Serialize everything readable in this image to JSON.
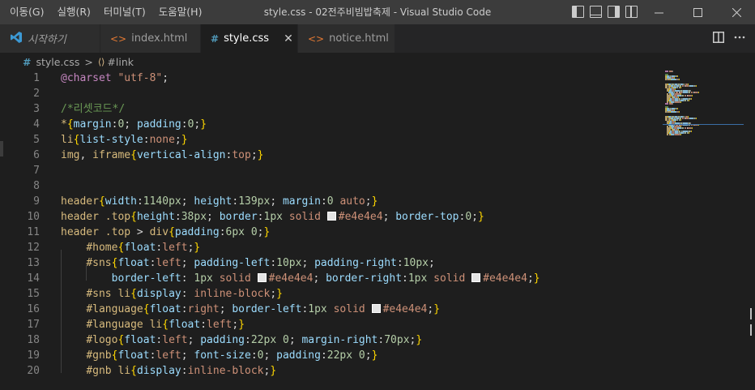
{
  "menu": [
    "이동(G)",
    "실행(R)",
    "터미널(T)",
    "도움말(H)"
  ],
  "window_title": "style.css - 02전주비빔밥축제 - Visual Studio Code",
  "window_controls": {
    "minimize": "—",
    "maximize": "☐",
    "close": "✕"
  },
  "tabs": [
    {
      "label": "시작하기",
      "icon": "vscode-logo-icon",
      "glyph": "◆",
      "color": "#3c99d4",
      "active": false
    },
    {
      "label": "index.html",
      "icon": "html-file-icon",
      "glyph": "<>",
      "color": "#e37933",
      "active": false
    },
    {
      "label": "style.css",
      "icon": "css-file-icon",
      "glyph": "#",
      "color": "#519aba",
      "active": true,
      "close": "✕"
    },
    {
      "label": "notice.html",
      "icon": "html-file-icon",
      "glyph": "<>",
      "color": "#e37933",
      "active": false
    }
  ],
  "breadcrumb": {
    "file": "style.css",
    "separator": ">",
    "symbol_icon": "⟨⟩",
    "symbol": "#link"
  },
  "line_numbers": [
    "1",
    "2",
    "3",
    "4",
    "5",
    "6",
    "7",
    "8",
    "9",
    "10",
    "11",
    "12",
    "13",
    "14",
    "15",
    "16",
    "17",
    "18",
    "19",
    "20"
  ],
  "code_lines": [
    [
      [
        "t-at",
        "@charset"
      ],
      [
        "t-punc",
        " "
      ],
      [
        "t-str",
        "\"utf-8\""
      ],
      [
        "t-punc",
        ";"
      ]
    ],
    [],
    [
      [
        "t-cm",
        "/*리셋코드*/"
      ]
    ],
    [
      [
        "t-sel",
        "*"
      ],
      [
        "t-br",
        "{"
      ],
      [
        "t-prop",
        "margin"
      ],
      [
        "t-punc",
        ":"
      ],
      [
        "t-num",
        "0"
      ],
      [
        "t-punc",
        "; "
      ],
      [
        "t-prop",
        "padding"
      ],
      [
        "t-punc",
        ":"
      ],
      [
        "t-num",
        "0"
      ],
      [
        "t-punc",
        ";"
      ],
      [
        "t-br",
        "}"
      ]
    ],
    [
      [
        "t-tag",
        "li"
      ],
      [
        "t-br",
        "{"
      ],
      [
        "t-prop",
        "list-style"
      ],
      [
        "t-punc",
        ":"
      ],
      [
        "t-val",
        "none"
      ],
      [
        "t-punc",
        ";"
      ],
      [
        "t-br",
        "}"
      ]
    ],
    [
      [
        "t-tag",
        "img"
      ],
      [
        "t-punc",
        ", "
      ],
      [
        "t-tag",
        "iframe"
      ],
      [
        "t-br",
        "{"
      ],
      [
        "t-prop",
        "vertical-align"
      ],
      [
        "t-punc",
        ":"
      ],
      [
        "t-val",
        "top"
      ],
      [
        "t-punc",
        ";"
      ],
      [
        "t-br",
        "}"
      ]
    ],
    [],
    [],
    [
      [
        "t-tag",
        "header"
      ],
      [
        "t-br",
        "{"
      ],
      [
        "t-prop",
        "width"
      ],
      [
        "t-punc",
        ":"
      ],
      [
        "t-num",
        "1140px"
      ],
      [
        "t-punc",
        "; "
      ],
      [
        "t-prop",
        "height"
      ],
      [
        "t-punc",
        ":"
      ],
      [
        "t-num",
        "139px"
      ],
      [
        "t-punc",
        "; "
      ],
      [
        "t-prop",
        "margin"
      ],
      [
        "t-punc",
        ":"
      ],
      [
        "t-num",
        "0"
      ],
      [
        "t-punc",
        " "
      ],
      [
        "t-val",
        "auto"
      ],
      [
        "t-punc",
        ";"
      ],
      [
        "t-br",
        "}"
      ]
    ],
    [
      [
        "t-tag",
        "header"
      ],
      [
        "t-punc",
        " "
      ],
      [
        "t-sel",
        ".top"
      ],
      [
        "t-br",
        "{"
      ],
      [
        "t-prop",
        "height"
      ],
      [
        "t-punc",
        ":"
      ],
      [
        "t-num",
        "38px"
      ],
      [
        "t-punc",
        "; "
      ],
      [
        "t-prop",
        "border"
      ],
      [
        "t-punc",
        ":"
      ],
      [
        "t-num",
        "1px"
      ],
      [
        "t-punc",
        " "
      ],
      [
        "t-val",
        "solid"
      ],
      [
        "t-punc",
        " "
      ],
      [
        "swatch",
        ""
      ],
      [
        "t-val",
        "#e4e4e4"
      ],
      [
        "t-punc",
        "; "
      ],
      [
        "t-prop",
        "border-top"
      ],
      [
        "t-punc",
        ":"
      ],
      [
        "t-num",
        "0"
      ],
      [
        "t-punc",
        ";"
      ],
      [
        "t-br",
        "}"
      ]
    ],
    [
      [
        "t-tag",
        "header"
      ],
      [
        "t-punc",
        " "
      ],
      [
        "t-sel",
        ".top"
      ],
      [
        "t-punc",
        " > "
      ],
      [
        "t-tag",
        "div"
      ],
      [
        "t-br",
        "{"
      ],
      [
        "t-prop",
        "padding"
      ],
      [
        "t-punc",
        ":"
      ],
      [
        "t-num",
        "6px"
      ],
      [
        "t-punc",
        " "
      ],
      [
        "t-num",
        "0"
      ],
      [
        "t-punc",
        ";"
      ],
      [
        "t-br",
        "}"
      ]
    ],
    [
      [
        "t-punc",
        "    "
      ],
      [
        "t-sel",
        "#home"
      ],
      [
        "t-br",
        "{"
      ],
      [
        "t-prop",
        "float"
      ],
      [
        "t-punc",
        ":"
      ],
      [
        "t-val",
        "left"
      ],
      [
        "t-punc",
        ";"
      ],
      [
        "t-br",
        "}"
      ]
    ],
    [
      [
        "t-punc",
        "    "
      ],
      [
        "t-sel",
        "#sns"
      ],
      [
        "t-br",
        "{"
      ],
      [
        "t-prop",
        "float"
      ],
      [
        "t-punc",
        ":"
      ],
      [
        "t-val",
        "left"
      ],
      [
        "t-punc",
        "; "
      ],
      [
        "t-prop",
        "padding-left"
      ],
      [
        "t-punc",
        ":"
      ],
      [
        "t-num",
        "10px"
      ],
      [
        "t-punc",
        "; "
      ],
      [
        "t-prop",
        "padding-right"
      ],
      [
        "t-punc",
        ":"
      ],
      [
        "t-num",
        "10px"
      ],
      [
        "t-punc",
        ";"
      ]
    ],
    [
      [
        "t-punc",
        "        "
      ],
      [
        "t-prop",
        "border-left"
      ],
      [
        "t-punc",
        ": "
      ],
      [
        "t-num",
        "1px"
      ],
      [
        "t-punc",
        " "
      ],
      [
        "t-val",
        "solid"
      ],
      [
        "t-punc",
        " "
      ],
      [
        "swatch",
        ""
      ],
      [
        "t-val",
        "#e4e4e4"
      ],
      [
        "t-punc",
        "; "
      ],
      [
        "t-prop",
        "border-right"
      ],
      [
        "t-punc",
        ":"
      ],
      [
        "t-num",
        "1px"
      ],
      [
        "t-punc",
        " "
      ],
      [
        "t-val",
        "solid"
      ],
      [
        "t-punc",
        " "
      ],
      [
        "swatch",
        ""
      ],
      [
        "t-val",
        "#e4e4e4"
      ],
      [
        "t-punc",
        ";"
      ],
      [
        "t-br",
        "}"
      ]
    ],
    [
      [
        "t-punc",
        "    "
      ],
      [
        "t-sel",
        "#sns"
      ],
      [
        "t-punc",
        " "
      ],
      [
        "t-tag",
        "li"
      ],
      [
        "t-br",
        "{"
      ],
      [
        "t-prop",
        "display"
      ],
      [
        "t-punc",
        ": "
      ],
      [
        "t-val",
        "inline-block"
      ],
      [
        "t-punc",
        ";"
      ],
      [
        "t-br",
        "}"
      ]
    ],
    [
      [
        "t-punc",
        "    "
      ],
      [
        "t-sel",
        "#language"
      ],
      [
        "t-br",
        "{"
      ],
      [
        "t-prop",
        "float"
      ],
      [
        "t-punc",
        ":"
      ],
      [
        "t-val",
        "right"
      ],
      [
        "t-punc",
        "; "
      ],
      [
        "t-prop",
        "border-left"
      ],
      [
        "t-punc",
        ":"
      ],
      [
        "t-num",
        "1px"
      ],
      [
        "t-punc",
        " "
      ],
      [
        "t-val",
        "solid"
      ],
      [
        "t-punc",
        " "
      ],
      [
        "swatch",
        ""
      ],
      [
        "t-val",
        "#e4e4e4"
      ],
      [
        "t-punc",
        ";"
      ],
      [
        "t-br",
        "}"
      ]
    ],
    [
      [
        "t-punc",
        "    "
      ],
      [
        "t-sel",
        "#language"
      ],
      [
        "t-punc",
        " "
      ],
      [
        "t-tag",
        "li"
      ],
      [
        "t-br",
        "{"
      ],
      [
        "t-prop",
        "float"
      ],
      [
        "t-punc",
        ":"
      ],
      [
        "t-val",
        "left"
      ],
      [
        "t-punc",
        ";"
      ],
      [
        "t-br",
        "}"
      ]
    ],
    [
      [
        "t-punc",
        "    "
      ],
      [
        "t-sel",
        "#logo"
      ],
      [
        "t-br",
        "{"
      ],
      [
        "t-prop",
        "float"
      ],
      [
        "t-punc",
        ":"
      ],
      [
        "t-val",
        "left"
      ],
      [
        "t-punc",
        "; "
      ],
      [
        "t-prop",
        "padding"
      ],
      [
        "t-punc",
        ":"
      ],
      [
        "t-num",
        "22px"
      ],
      [
        "t-punc",
        " "
      ],
      [
        "t-num",
        "0"
      ],
      [
        "t-punc",
        "; "
      ],
      [
        "t-prop",
        "margin-right"
      ],
      [
        "t-punc",
        ":"
      ],
      [
        "t-num",
        "70px"
      ],
      [
        "t-punc",
        ";"
      ],
      [
        "t-br",
        "}"
      ]
    ],
    [
      [
        "t-punc",
        "    "
      ],
      [
        "t-sel",
        "#gnb"
      ],
      [
        "t-br",
        "{"
      ],
      [
        "t-prop",
        "float"
      ],
      [
        "t-punc",
        ":"
      ],
      [
        "t-val",
        "left"
      ],
      [
        "t-punc",
        "; "
      ],
      [
        "t-prop",
        "font-size"
      ],
      [
        "t-punc",
        ":"
      ],
      [
        "t-num",
        "0"
      ],
      [
        "t-punc",
        "; "
      ],
      [
        "t-prop",
        "padding"
      ],
      [
        "t-punc",
        ":"
      ],
      [
        "t-num",
        "22px"
      ],
      [
        "t-punc",
        " "
      ],
      [
        "t-num",
        "0"
      ],
      [
        "t-punc",
        ";"
      ],
      [
        "t-br",
        "}"
      ]
    ],
    [
      [
        "t-punc",
        "    "
      ],
      [
        "t-sel",
        "#gnb"
      ],
      [
        "t-punc",
        " "
      ],
      [
        "t-tag",
        "li"
      ],
      [
        "t-br",
        "{"
      ],
      [
        "t-prop",
        "display"
      ],
      [
        "t-punc",
        ":"
      ],
      [
        "t-val",
        "inline-block"
      ],
      [
        "t-punc",
        ";"
      ],
      [
        "t-br",
        "}"
      ]
    ]
  ],
  "colors": {
    "titlebar": "#3c3c3c",
    "editor_bg": "#1e1e1e",
    "swatch": "#e4e4e4"
  }
}
